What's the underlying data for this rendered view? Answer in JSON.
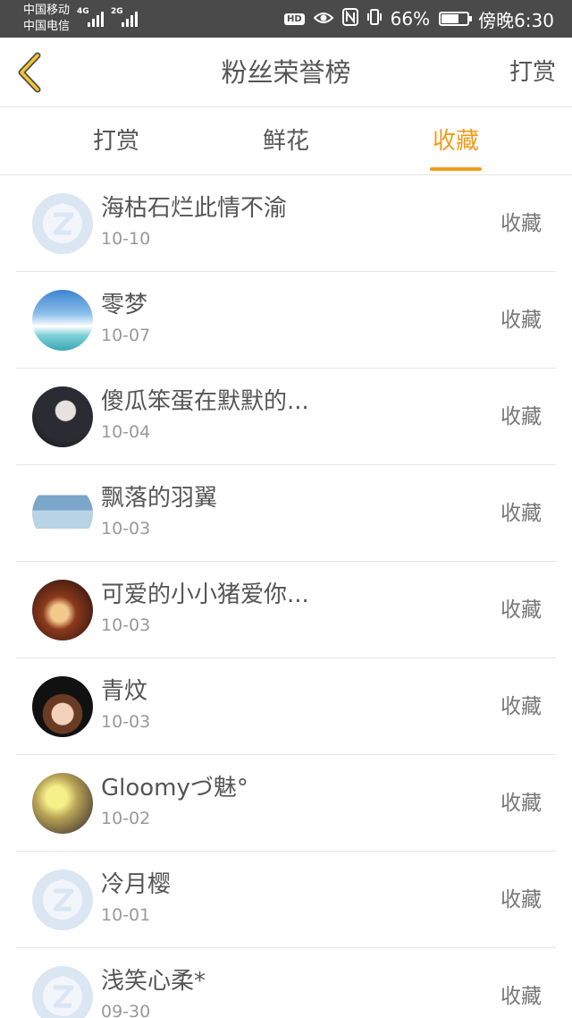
{
  "status_bar": {
    "carrier_1": "中国移动",
    "carrier_2": "中国电信",
    "network_1": "4G",
    "network_2": "2G",
    "hd": "HD",
    "battery": "66%",
    "battery_level": 0.66,
    "time": "傍晚6:30",
    "icons": [
      "eye-icon",
      "nfc-icon",
      "vibrate-icon",
      "battery-icon"
    ]
  },
  "header": {
    "title": "粉丝荣誉榜",
    "action": "打赏",
    "back_icon": "chevron-left-icon",
    "accent": "#ef9c1f"
  },
  "tabs": [
    {
      "label": "打赏",
      "active": false
    },
    {
      "label": "鲜花",
      "active": false
    },
    {
      "label": "收藏",
      "active": true
    }
  ],
  "list": [
    {
      "name": "海枯石烂此情不渝",
      "date": "10-10",
      "type": "收藏",
      "avatar": "default-avatar"
    },
    {
      "name": "零梦",
      "date": "10-07",
      "type": "收藏",
      "avatar": "sky-photo"
    },
    {
      "name": "傻瓜笨蛋在默默的...",
      "date": "10-04",
      "type": "收藏",
      "avatar": "girl-photo"
    },
    {
      "name": "飘落的羽翼",
      "date": "10-03",
      "type": "收藏",
      "avatar": "cap-photo"
    },
    {
      "name": "可爱的小小猪爱你...",
      "date": "10-03",
      "type": "收藏",
      "avatar": "warm-photo"
    },
    {
      "name": "青炆",
      "date": "10-03",
      "type": "收藏",
      "avatar": "boy-cartoon"
    },
    {
      "name": "Gloomyづ魅°",
      "date": "10-02",
      "type": "收藏",
      "avatar": "glow-photo"
    },
    {
      "name": "冷月樱",
      "date": "10-01",
      "type": "收藏",
      "avatar": "default-avatar"
    },
    {
      "name": "浅笑心柔*",
      "date": "09-30",
      "type": "收藏",
      "avatar": "default-avatar"
    }
  ]
}
